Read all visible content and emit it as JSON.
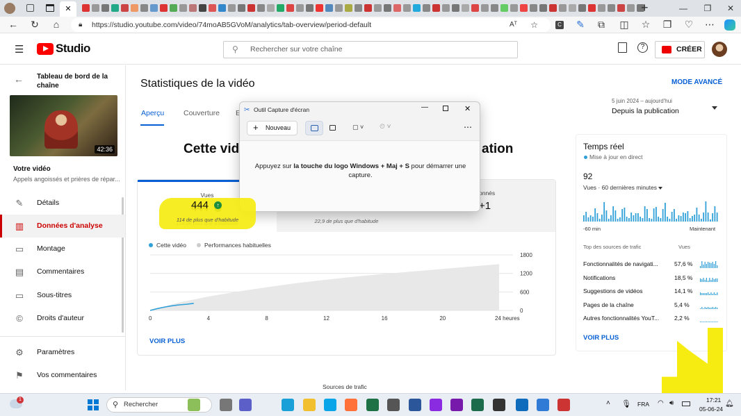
{
  "browser": {
    "url": "https://studio.youtube.com/video/74moAB5GVoM/analytics/tab-overview/period-default",
    "reader_icon": "Aᵀ",
    "window_controls": [
      "—",
      "❐",
      "✕"
    ],
    "new_tab": "+"
  },
  "header": {
    "logo_text": "Studio",
    "search_placeholder": "Rechercher sur votre chaîne",
    "create_label": "CRÉER"
  },
  "sidebar": {
    "back_title": "Tableau de bord de la chaîne",
    "thumb_duration": "42:36",
    "video_heading": "Votre vidéo",
    "video_title": "Appels angoissés et prières de répar...",
    "items": [
      {
        "label": "Détails",
        "icon": "pencil-icon"
      },
      {
        "label": "Données d'analyse",
        "icon": "analytics-icon"
      },
      {
        "label": "Montage",
        "icon": "editor-icon"
      },
      {
        "label": "Commentaires",
        "icon": "comments-icon"
      },
      {
        "label": "Sous-titres",
        "icon": "subtitles-icon"
      },
      {
        "label": "Droits d'auteur",
        "icon": "copyright-icon"
      },
      {
        "label": "Paramètres",
        "icon": "gear-icon"
      },
      {
        "label": "Vos commentaires",
        "icon": "feedback-icon"
      }
    ]
  },
  "main": {
    "page_title": "Statistiques de la vidéo",
    "advanced_mode": "MODE AVANCÉ",
    "period_range": "5 juin 2024 – aujourd'hui",
    "period_label": "Depuis la publication",
    "tabs": [
      "Aperçu",
      "Couverture",
      "E"
    ],
    "headline_left": "Cette vidé",
    "headline_right": "ation",
    "metrics": [
      {
        "label": "Vues",
        "value": "444",
        "note": "114 de plus que d'habitude"
      },
      {
        "label": "",
        "value": "",
        "note": "22,9 de plus que d'habitude"
      },
      {
        "label": "onnés",
        "value": "+1",
        "note": ""
      }
    ],
    "legend": {
      "this_video": "Cette vidéo",
      "typical": "Performances habituelles"
    },
    "see_more": "VOIR PLUS",
    "traffic_sources_label": "Sources de trafic"
  },
  "chart_data": {
    "type": "area",
    "x_ticks": [
      "0",
      "4",
      "8",
      "12",
      "16",
      "20",
      "24 heures"
    ],
    "y_ticks": [
      "1800",
      "1200",
      "600",
      "0"
    ],
    "ylim": [
      0,
      1800
    ],
    "xlim": [
      0,
      24
    ],
    "series": [
      {
        "name": "Cette vidéo",
        "color": "#2fa0d8",
        "x": [
          0,
          0.5,
          1,
          1.5,
          2,
          2.5,
          3
        ],
        "y": [
          0,
          60,
          110,
          150,
          180,
          200,
          230
        ]
      },
      {
        "name": "Performances habituelles",
        "color": "#e8e8e8",
        "x": [
          0,
          2,
          4,
          6,
          8,
          10,
          12,
          14,
          16,
          18,
          20,
          22,
          24
        ],
        "y": [
          0,
          260,
          450,
          610,
          750,
          880,
          990,
          1090,
          1180,
          1260,
          1340,
          1420,
          1500
        ]
      }
    ]
  },
  "realtime": {
    "title": "Temps réel",
    "subtitle": "Mise à jour en direct",
    "count": "92",
    "count_label": "Vues · 60 dernières minutes",
    "axis_left": "-60 min",
    "axis_right": "Maintenant",
    "sources_header": "Top des sources de trafic",
    "sources_col": "Vues",
    "sources": [
      {
        "name": "Fonctionnalités de navigati...",
        "pct": "57,6 %"
      },
      {
        "name": "Notifications",
        "pct": "18,5 %"
      },
      {
        "name": "Suggestions de vidéos",
        "pct": "14,1 %"
      },
      {
        "name": "Pages de la chaîne",
        "pct": "5,4 %"
      },
      {
        "name": "Autres fonctionnalités YouT...",
        "pct": "2,2 %"
      }
    ],
    "see_more": "VOIR PLUS"
  },
  "snip": {
    "title": "Outil Capture d'écran",
    "new_label": "Nouveau",
    "message_pre": "Appuyez sur ",
    "message_bold": "la touche du logo Windows + Maj + S",
    "message_post": " pour démarrer une capture."
  },
  "taskbar": {
    "search_placeholder": "Rechercher",
    "notif_badge": "1",
    "lang": "FRA",
    "time": "17:21",
    "date": "05-06-24"
  }
}
